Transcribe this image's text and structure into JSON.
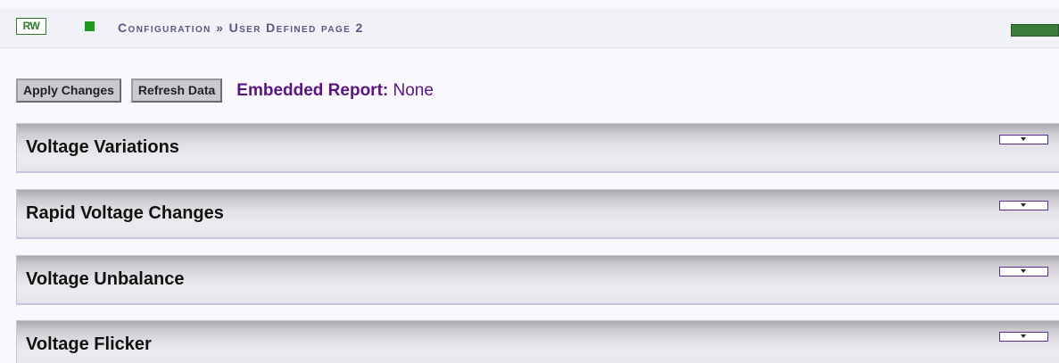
{
  "header": {
    "rw_badge": "RW",
    "breadcrumb_section": "Configuration",
    "breadcrumb_separator": " » ",
    "breadcrumb_page": "User Defined page 2"
  },
  "toolbar": {
    "apply_label": "Apply Changes",
    "refresh_label": "Refresh Data",
    "embedded_report_label": "Embedded Report:",
    "embedded_report_value": "None"
  },
  "panels": [
    {
      "title": "Voltage Variations"
    },
    {
      "title": "Rapid Voltage Changes"
    },
    {
      "title": "Voltage Unbalance"
    },
    {
      "title": "Voltage Flicker"
    }
  ],
  "colors": {
    "rw_green": "#2f7a2f",
    "status_green": "#3a7d3a",
    "breadcrumb": "#5a5780",
    "embedded_report": "#5b1480",
    "toggle_border": "#5b2e8a"
  },
  "icons": {
    "status_square": "green-square-icon",
    "panel_toggle": "chevron-down-icon"
  }
}
